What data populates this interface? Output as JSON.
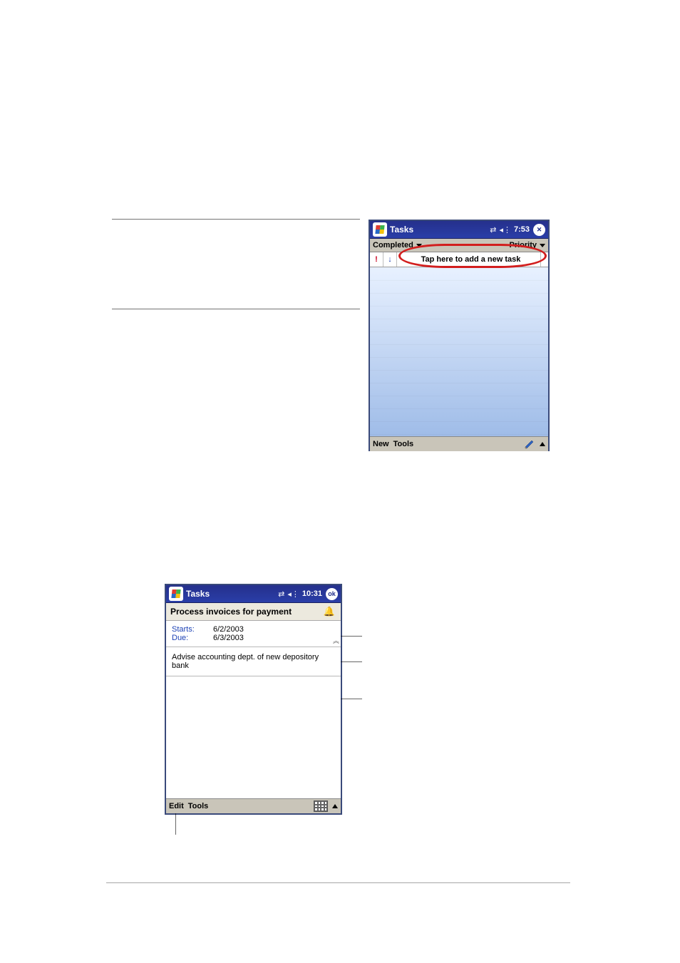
{
  "device1": {
    "title": "Tasks",
    "clock": "7:53",
    "close_glyph": "✕",
    "filter_left": "Completed",
    "filter_right": "Priority",
    "priority_glyph": "!",
    "sort_glyph": "↓",
    "entry_prompt": "Tap here to add a new task",
    "menu_new": "New",
    "menu_tools": "Tools"
  },
  "device2": {
    "title": "Tasks",
    "clock": "10:31",
    "ok_label": "ok",
    "task_name": "Process invoices for payment",
    "starts_label": "Starts:",
    "starts_value": "6/2/2003",
    "due_label": "Due:",
    "due_value": "6/3/2003",
    "note": "Advise accounting dept. of new depository bank",
    "menu_edit": "Edit",
    "menu_tools": "Tools"
  }
}
